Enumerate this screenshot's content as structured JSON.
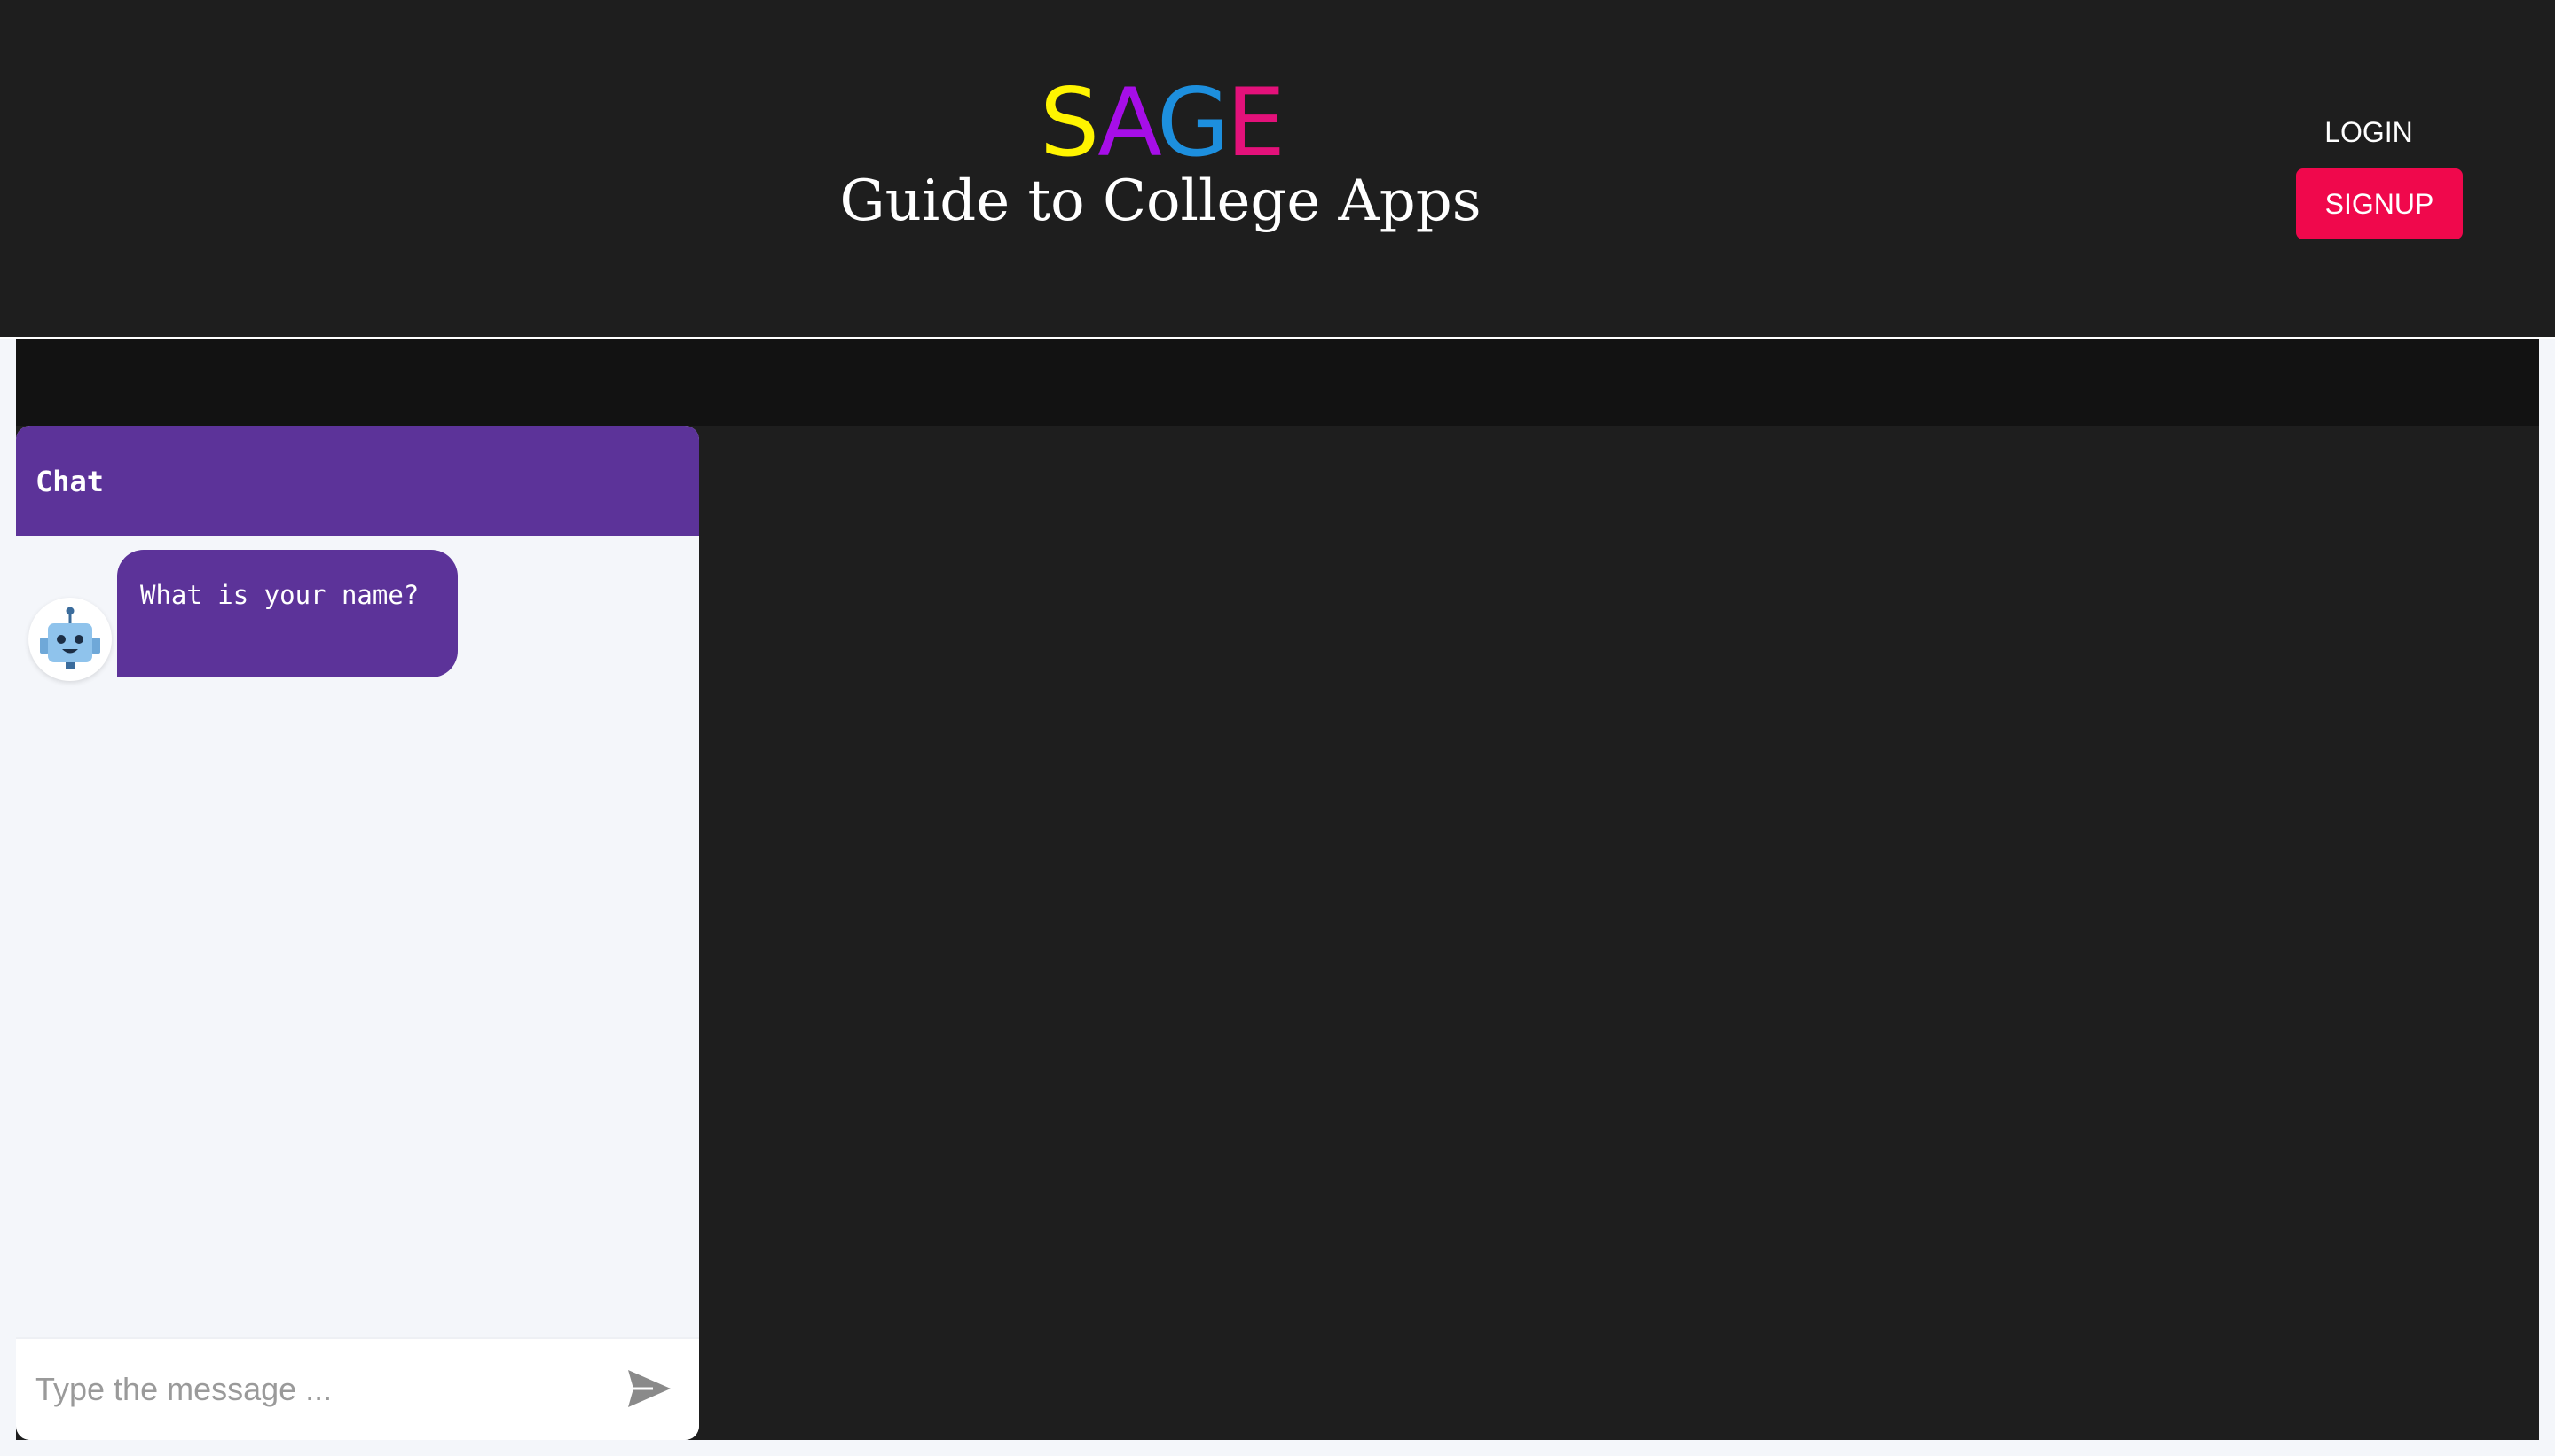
{
  "header": {
    "logo_letters": [
      {
        "char": "S",
        "color": "#fff400"
      },
      {
        "char": "A",
        "color": "#a60ee8"
      },
      {
        "char": "G",
        "color": "#1d8fde"
      },
      {
        "char": "E",
        "color": "#e3117a"
      }
    ],
    "subtitle": "Guide to College Apps",
    "login_label": "LOGIN",
    "signup_label": "SIGNUP"
  },
  "chat": {
    "title": "Chat",
    "messages": [
      {
        "sender": "bot",
        "avatar_icon": "robot-icon",
        "text": "What is your name?"
      }
    ],
    "input_placeholder": "Type the message ...",
    "input_value": "",
    "send_icon": "send-icon"
  },
  "colors": {
    "header_bg": "#1e1e1e",
    "accent_purple": "#5c3399",
    "signup_pink": "#f0084c",
    "chat_bg": "#f4f6fa"
  }
}
